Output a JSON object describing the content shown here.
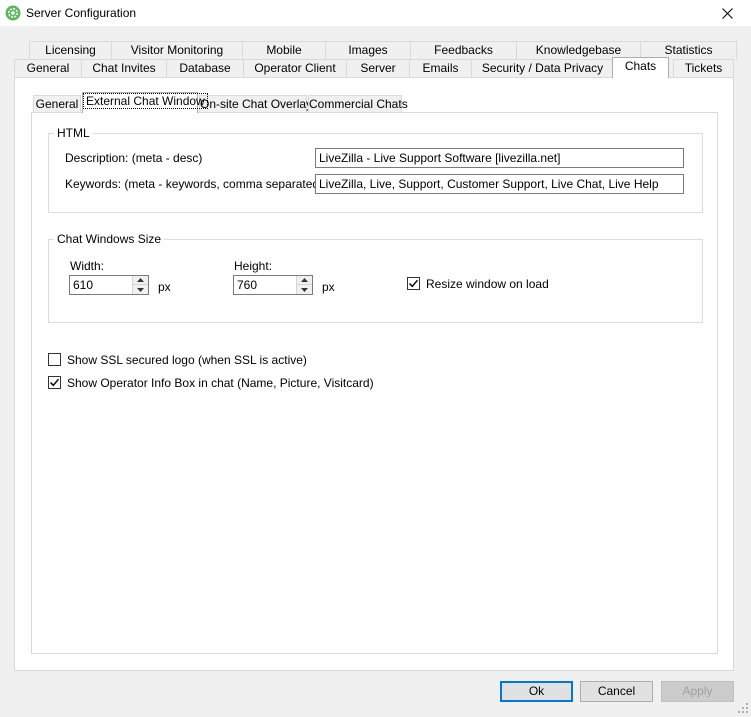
{
  "window": {
    "title": "Server Configuration"
  },
  "outer_tabs_row1": [
    {
      "label": "Licensing"
    },
    {
      "label": "Visitor Monitoring"
    },
    {
      "label": "Mobile"
    },
    {
      "label": "Images"
    },
    {
      "label": "Feedbacks"
    },
    {
      "label": "Knowledgebase"
    },
    {
      "label": "Statistics"
    }
  ],
  "outer_tabs_row2": [
    {
      "label": "General"
    },
    {
      "label": "Chat Invites"
    },
    {
      "label": "Database"
    },
    {
      "label": "Operator Client"
    },
    {
      "label": "Server"
    },
    {
      "label": "Emails"
    },
    {
      "label": "Security / Data Privacy"
    },
    {
      "label": "Chats"
    },
    {
      "label": "Tickets"
    }
  ],
  "outer_selected": "Chats",
  "inner_tabs": [
    {
      "label": "General"
    },
    {
      "label": "External Chat Window"
    },
    {
      "label": "On-site Chat Overlay"
    },
    {
      "label": "Commercial Chats"
    }
  ],
  "inner_selected": "External Chat Window",
  "html_group": {
    "title": "HTML",
    "description_label": "Description: (meta - desc)",
    "description_value": "LiveZilla - Live Support Software [livezilla.net]",
    "keywords_label": "Keywords: (meta - keywords, comma separated)",
    "keywords_value": "LiveZilla, Live, Support, Customer Support, Live Chat, Live Help"
  },
  "size_group": {
    "title": "Chat Windows Size",
    "width_label": "Width:",
    "width_value": "610",
    "width_unit": "px",
    "height_label": "Height:",
    "height_value": "760",
    "height_unit": "px",
    "resize_label": "Resize window on load",
    "resize_checked": true
  },
  "options": {
    "ssl_logo_label": "Show SSL secured logo (when SSL is active)",
    "ssl_logo_checked": false,
    "operator_info_label": "Show Operator Info Box in chat (Name, Picture, Visitcard)",
    "operator_info_checked": true
  },
  "buttons": {
    "ok": "Ok",
    "cancel": "Cancel",
    "apply": "Apply"
  },
  "colors": {
    "accent": "#0078d7",
    "window_bg": "#f0f0f0",
    "panel_bg": "#ffffff",
    "icon_green": "#5cb85c"
  },
  "icons": {
    "app": "gear-icon",
    "close": "close-icon",
    "spin_up": "arrow-up-icon",
    "spin_down": "arrow-down-icon",
    "check": "checkmark-icon",
    "grip": "resize-grip-icon"
  }
}
